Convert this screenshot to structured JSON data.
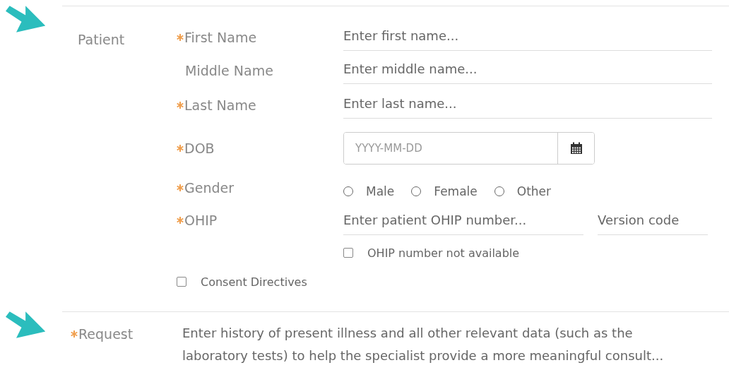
{
  "patient_section": {
    "title": "Patient",
    "fields": [
      {
        "kind": "text",
        "label": "First Name",
        "required": true,
        "placeholder": "Enter first name..."
      },
      {
        "kind": "text",
        "label": "Middle Name",
        "required": false,
        "placeholder": "Enter middle name..."
      },
      {
        "kind": "text",
        "label": "Last Name",
        "required": true,
        "placeholder": "Enter last name..."
      },
      {
        "kind": "date",
        "label": "DOB",
        "required": true,
        "placeholder": "YYYY-MM-DD"
      },
      {
        "kind": "radio",
        "label": "Gender",
        "required": true,
        "options": [
          {
            "label": "Male",
            "selected": false
          },
          {
            "label": "Female",
            "selected": false
          },
          {
            "label": "Other",
            "selected": false
          }
        ]
      },
      {
        "kind": "ohip",
        "label": "OHIP",
        "required": true,
        "placeholder": "Enter patient OHIP number...",
        "version_placeholder": "Version code",
        "checkbox": {
          "label": "OHIP number not available",
          "checked": false
        }
      }
    ],
    "consent": {
      "label": "Consent Directives",
      "checked": false
    }
  },
  "request_section": {
    "label": "Request",
    "required": true,
    "placeholder": "Enter history of present illness and all other relevant data (such as the laboratory tests) to help the specialist provide a more meaningful consult..."
  }
}
